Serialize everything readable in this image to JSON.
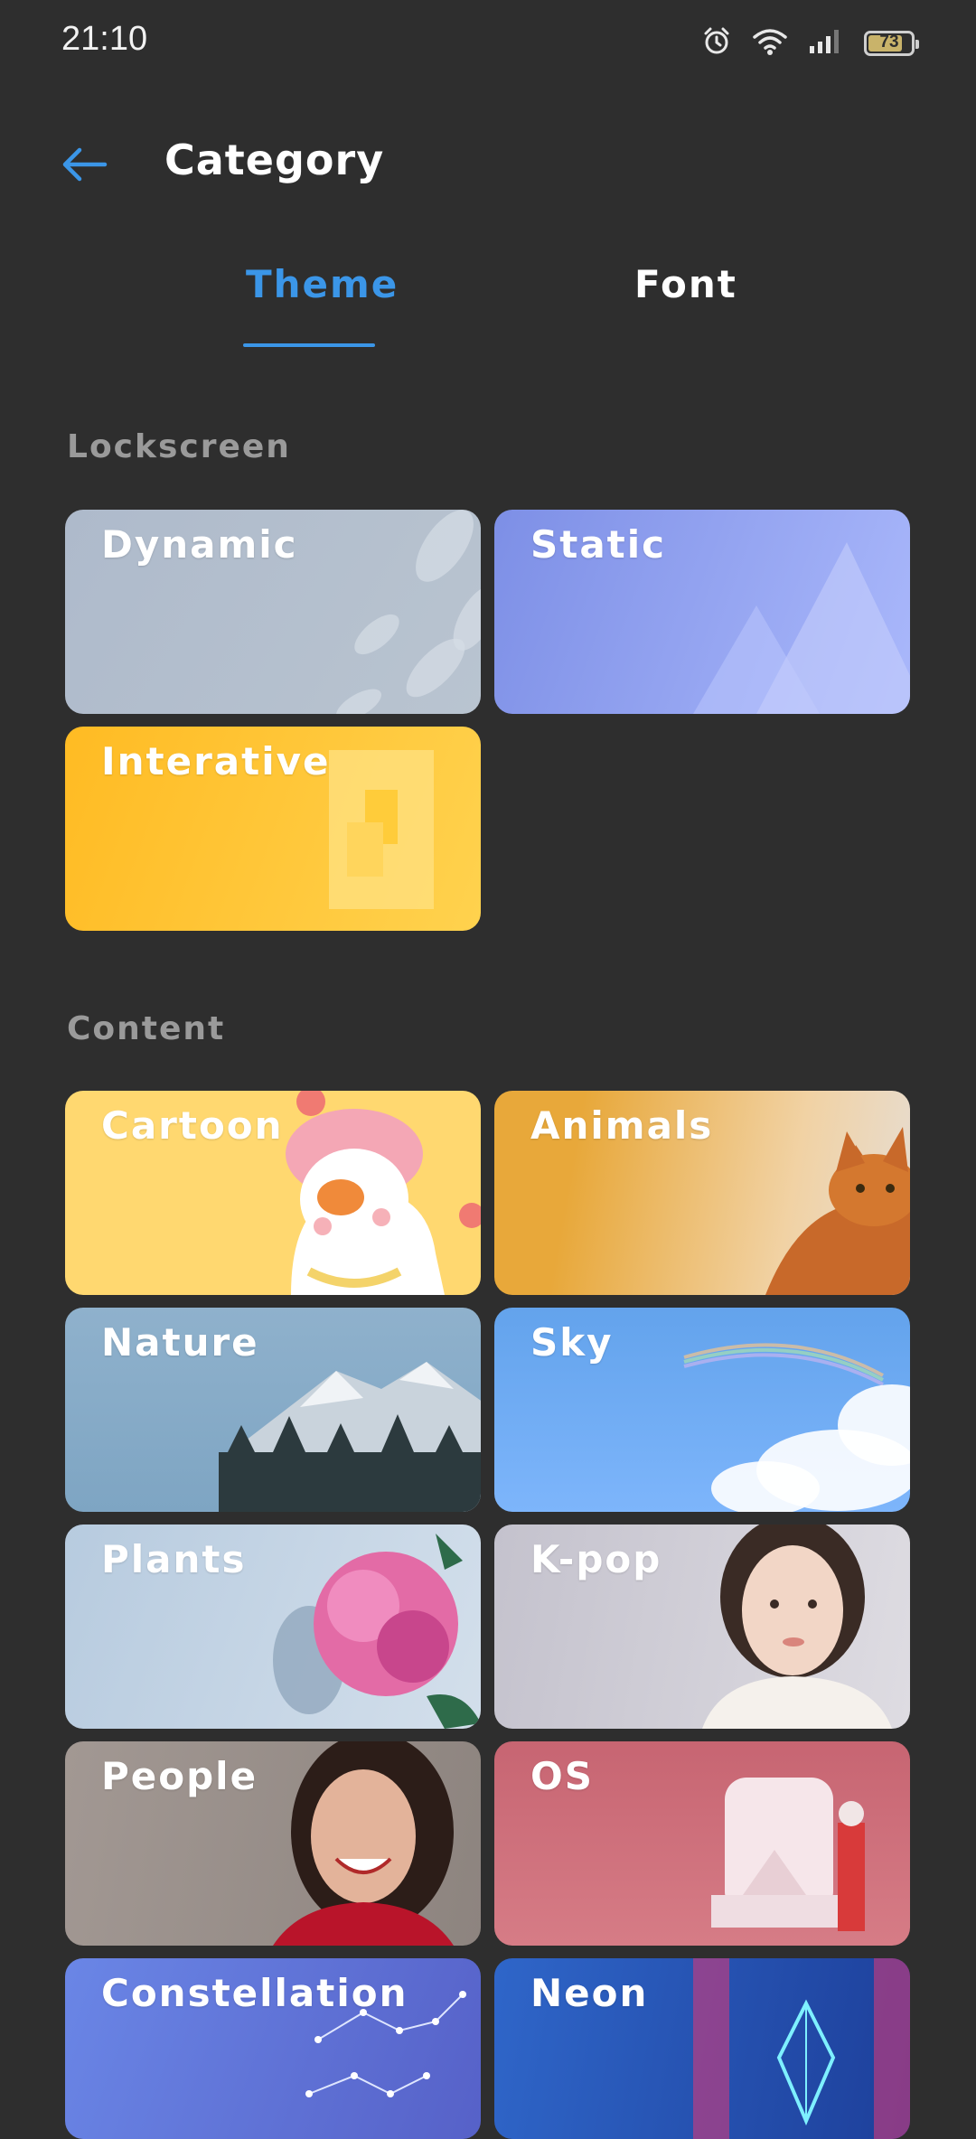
{
  "status": {
    "time": "21:10",
    "battery": "73"
  },
  "header": {
    "title": "Category"
  },
  "tabs": {
    "theme": "Theme",
    "font": "Font"
  },
  "sections": {
    "lockscreen": "Lockscreen",
    "content": "Content"
  },
  "lockscreen_cards": {
    "dynamic": "Dynamic",
    "static": "Static",
    "interative": "Interative"
  },
  "content_cards": {
    "cartoon": "Cartoon",
    "animals": "Animals",
    "nature": "Nature",
    "sky": "Sky",
    "plants": "Plants",
    "kpop": "K-pop",
    "people": "People",
    "os": "OS",
    "constellation": "Constellation",
    "neon": "Neon"
  },
  "colors": {
    "accent": "#3b96e8",
    "background": "#2e2e2e",
    "section_label": "#9a9a9a"
  }
}
